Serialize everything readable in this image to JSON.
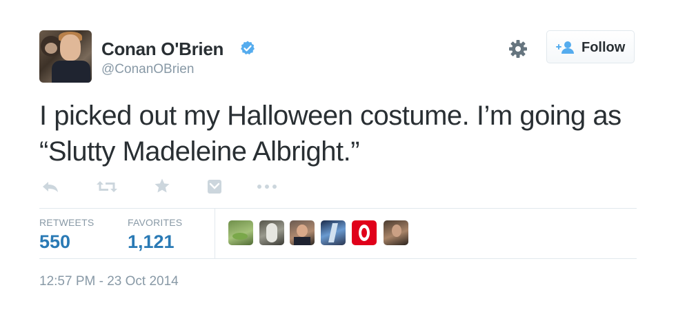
{
  "user": {
    "name": "Conan O'Brien",
    "handle": "@ConanOBrien",
    "verified": true
  },
  "follow_button": {
    "label": "Follow"
  },
  "tweet": {
    "text": "I picked out my Halloween costume. I’m going as “Slutty Madeleine Albright.”"
  },
  "actions": [
    {
      "icon": "reply-icon"
    },
    {
      "icon": "retweet-icon"
    },
    {
      "icon": "favorite-star-icon"
    },
    {
      "icon": "pocket-icon"
    },
    {
      "icon": "more-dots-icon"
    }
  ],
  "stats": {
    "retweets_label": "RETWEETS",
    "retweets_value": "550",
    "favorites_label": "FAVORITES",
    "favorites_value": "1,121"
  },
  "favoriters": [
    {
      "icon": "favoriter-avatar-1"
    },
    {
      "icon": "favoriter-avatar-2"
    },
    {
      "icon": "favoriter-avatar-3"
    },
    {
      "icon": "favoriter-avatar-4"
    },
    {
      "icon": "favoriter-avatar-5"
    },
    {
      "icon": "favoriter-avatar-6"
    }
  ],
  "timestamp": "12:57 PM - 23 Oct 2014",
  "colors": {
    "text": "#292f33",
    "muted": "#8899a6",
    "link_blue": "#2a7ab5",
    "verified_blue": "#55acee",
    "divider": "#e1e8ed"
  }
}
